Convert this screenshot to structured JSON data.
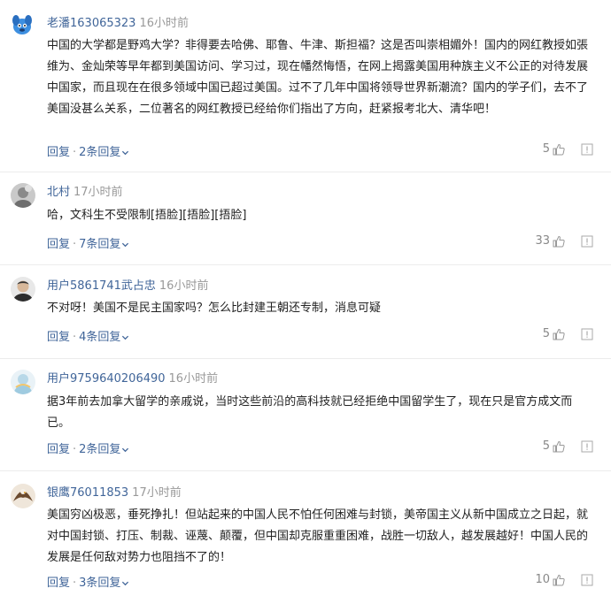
{
  "comments": [
    {
      "username": "老潘163065323",
      "time": "16小时前",
      "text": "中国的大学都是野鸡大学？非得要去哈佛、耶鲁、牛津、斯担福？这是否叫崇相媚外！国内的网红教授如張维为、金灿荣等早年都到美国访问、学习过，现在幡然悔悟，在网上揭露美国用种族主义不公正的对待发展中国家，而且现在在很多领域中国已超过美国。过不了几年中国将领导世界新潮流？国内的学子们，去不了美国没甚么关系，二位著名的网红教授已经给你们指出了方向，赶紧报考北大、清华吧！",
      "reply_label": "回复",
      "replies_label": "2条回复",
      "likes": "5",
      "avatar": "blue-cartoon-dog"
    },
    {
      "username": "北村",
      "time": "17小时前",
      "text": "哈，文科生不受限制[捂脸][捂脸][捂脸]",
      "reply_label": "回复",
      "replies_label": "7条回复",
      "likes": "33",
      "avatar": "grey-photo"
    },
    {
      "username": "用户5861741武占忠",
      "time": "16小时前",
      "text": "不对呀！美国不是民主国家吗？怎么比封建王朝还专制，消息可疑",
      "reply_label": "回复",
      "replies_label": "4条回复",
      "likes": "5",
      "avatar": "man-portrait"
    },
    {
      "username": "用户9759640206490",
      "time": "16小时前",
      "text": "据3年前去加拿大留学的亲戚说，当时这些前沿的高科技就已经拒绝中国留学生了，现在只是官方成文而已。",
      "reply_label": "回复",
      "replies_label": "2条回复",
      "likes": "5",
      "avatar": "default-light-blue"
    },
    {
      "username": "银鹰76011853",
      "time": "17小时前",
      "text": "美国穷凶极恶，垂死挣扎！但站起来的中国人民不怕任何困难与封锁，美帝国主义从新中国成立之日起，就对中国封锁、打压、制裁、诬蔑、颠覆，但中国却克服重重困难，战胜一切敌人，越发展越好！中国人民的发展是任何敌对势力也阻挡不了的！",
      "reply_label": "回复",
      "replies_label": "3条回复",
      "likes": "10",
      "avatar": "eagle-photo"
    }
  ],
  "colors": {
    "username": "#406599",
    "meta": "#999999",
    "text": "#222222",
    "divider": "#ececec"
  }
}
